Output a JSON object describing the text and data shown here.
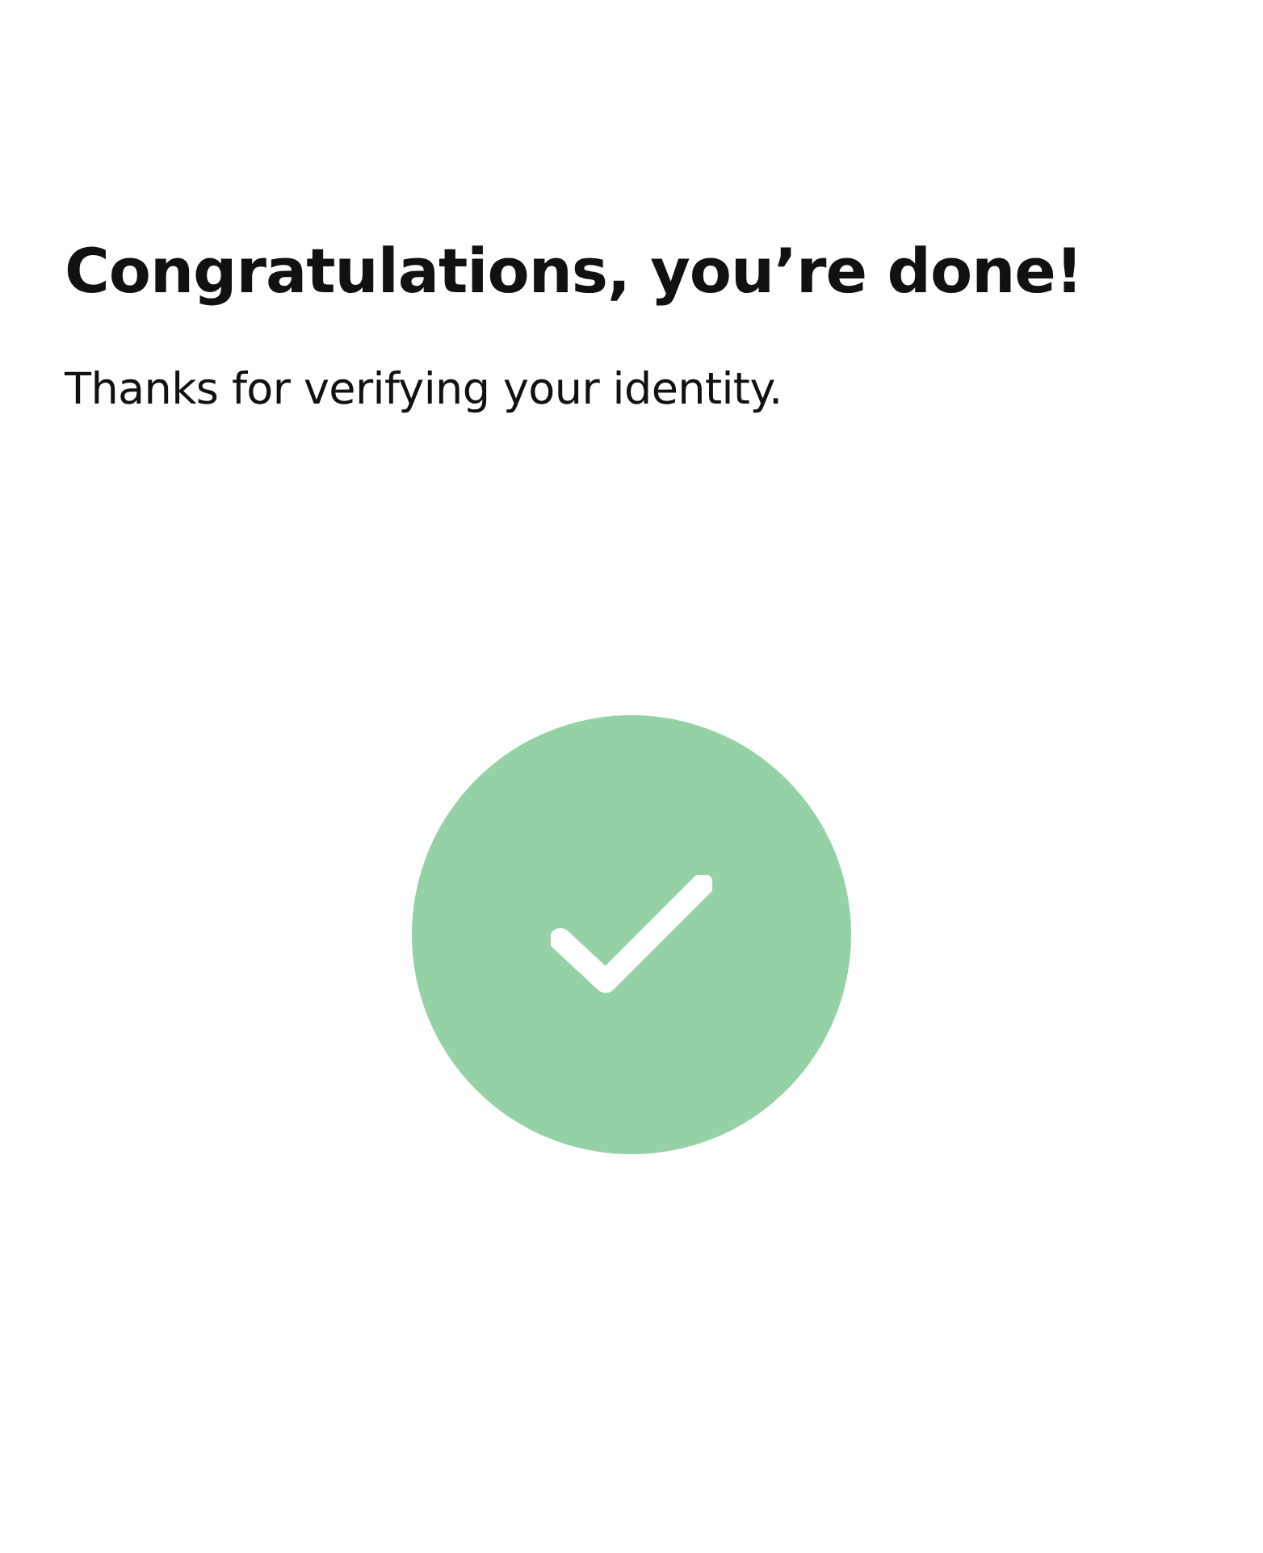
{
  "title": "Congratulations, you’re done!",
  "message": "Thanks for verifying your identity.",
  "status": {
    "kind": "success",
    "color": "#94d2a6"
  }
}
